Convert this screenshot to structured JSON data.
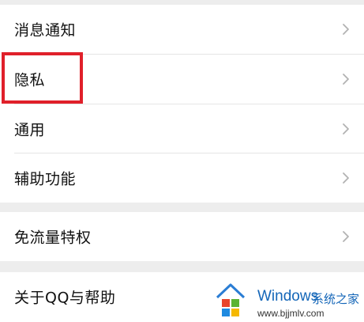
{
  "settings": {
    "items": [
      {
        "label": "消息通知"
      },
      {
        "label": "隐私"
      },
      {
        "label": "通用"
      },
      {
        "label": "辅助功能"
      },
      {
        "label": "免流量特权"
      },
      {
        "label": "关于QQ与帮助"
      }
    ],
    "chevron_icon": "chevron-right-icon"
  },
  "highlight": {
    "target": "隐私",
    "color": "#e0202a"
  },
  "watermark": {
    "title": "Windows",
    "subtitle": "系统之家",
    "url": "www.bjjmlv.com",
    "logo_icon": "windows-logo-icon"
  },
  "colors": {
    "background": "#ededed",
    "row": "#ffffff",
    "divider": "#e5e5e5",
    "text": "#111111",
    "chevron": "#b2b2b2"
  }
}
